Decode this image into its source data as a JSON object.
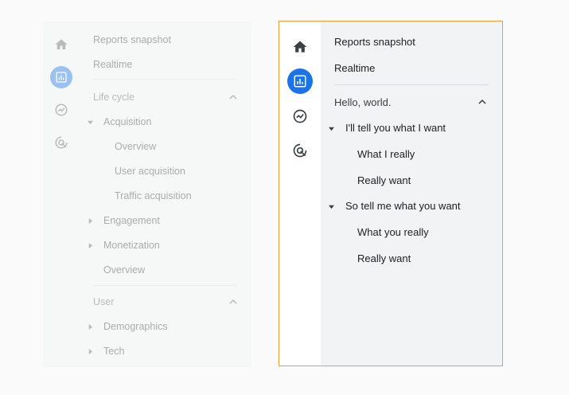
{
  "left_panel": {
    "nav": [
      "home-icon",
      "reports-icon",
      "explore-icon",
      "advertising-icon"
    ],
    "top_items": [
      "Reports snapshot",
      "Realtime"
    ],
    "section1": {
      "title": "Life cycle",
      "groups": [
        {
          "label": "Acquisition",
          "expanded": true,
          "children": [
            "Overview",
            "User acquisition",
            "Traffic acquisition"
          ]
        },
        {
          "label": "Engagement",
          "expanded": false,
          "children": []
        },
        {
          "label": "Monetization",
          "expanded": false,
          "children": []
        }
      ],
      "trailing": "Overview"
    },
    "section2": {
      "title": "User",
      "groups": [
        {
          "label": "Demographics",
          "expanded": false
        },
        {
          "label": "Tech",
          "expanded": false
        }
      ]
    }
  },
  "right_panel": {
    "top_items": [
      "Reports snapshot",
      "Realtime"
    ],
    "section": {
      "title": "Hello, world.",
      "groups": [
        {
          "label": "I'll tell you what I want",
          "expanded": true,
          "children": [
            "What I really",
            "Really want"
          ]
        },
        {
          "label": "So tell me what you want",
          "expanded": true,
          "children": [
            "What you really",
            "Really want"
          ]
        }
      ]
    }
  },
  "colors": {
    "accent": "#1a73e8",
    "highlight_border": "#f29b38",
    "panel_bg": "#f1f3f4"
  }
}
